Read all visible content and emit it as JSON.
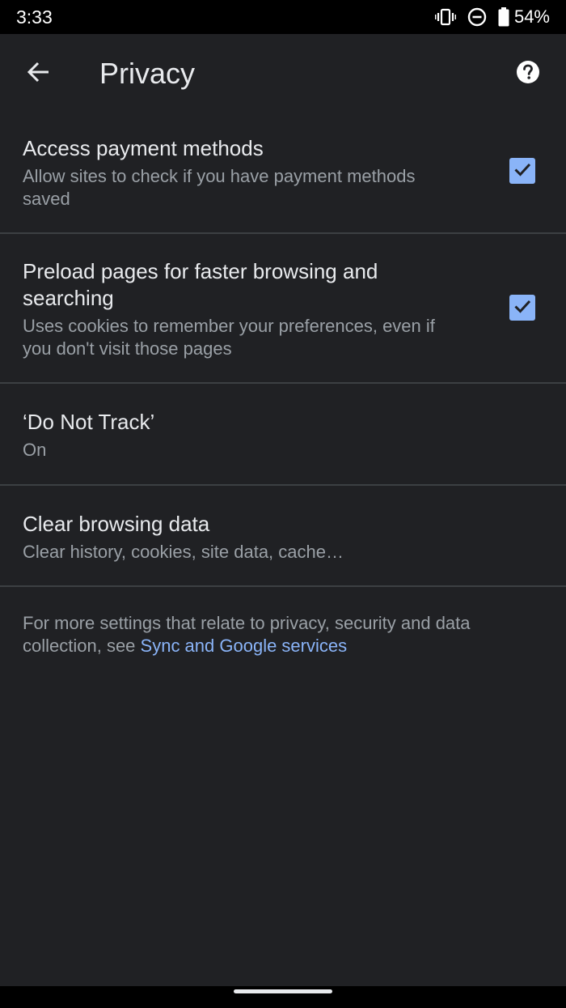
{
  "status_bar": {
    "time": "3:33",
    "battery": "54%",
    "icons": [
      "vibrate-icon",
      "do-not-disturb-icon",
      "battery-icon"
    ]
  },
  "app_bar": {
    "title": "Privacy",
    "icons": [
      "back-arrow-icon",
      "help-icon"
    ]
  },
  "settings": {
    "payment": {
      "title": "Access payment methods",
      "summary": "Allow sites to check if you have payment methods saved",
      "checked": true
    },
    "preload": {
      "title": "Preload pages for faster browsing and searching",
      "summary": "Uses cookies to remember your preferences, even if you don't visit those pages",
      "checked": true
    },
    "dnt": {
      "title": "‘Do Not Track’",
      "summary": "On"
    },
    "clear": {
      "title": "Clear browsing data",
      "summary": "Clear history, cookies, site data, cache…"
    }
  },
  "footer": {
    "text": "For more settings that relate to privacy, security and data collection, see ",
    "link": "Sync and Google services"
  },
  "colors": {
    "background": "#202124",
    "accent": "#8ab4f8",
    "divider": "#3c4043",
    "primary_text": "#e8eaed",
    "secondary_text": "#9aa0a6"
  }
}
